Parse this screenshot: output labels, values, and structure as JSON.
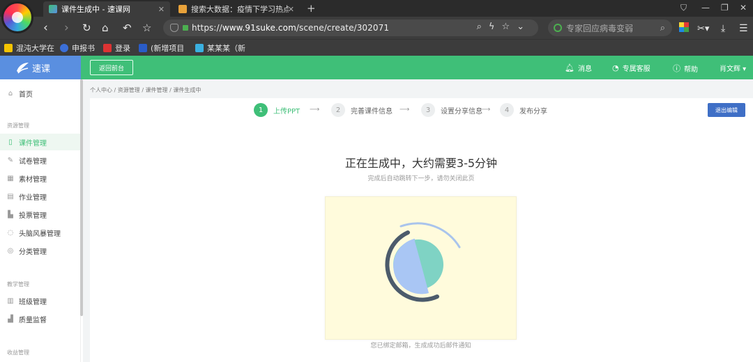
{
  "browser": {
    "tabs": [
      {
        "label": "课件生成中 - 速课网",
        "active": true
      },
      {
        "label": "搜索大数据：疫情下学习热点",
        "active": false
      }
    ],
    "address": {
      "scheme": "https://",
      "domain": "www.91suke.com",
      "path": "/scene/create/302071"
    },
    "search_placeholder": "专家回应病毒变弱",
    "bookmarks": [
      {
        "label": "混沌大学在",
        "color": "#f5c400"
      },
      {
        "label": "申报书",
        "color": "#3b6fd8"
      },
      {
        "label": "登录",
        "color": "#d33"
      },
      {
        "label": "(新增项目",
        "color": "#2a5cc8"
      },
      {
        "label": "某某某（新",
        "color": "#3ab0e0"
      }
    ]
  },
  "app": {
    "brand": "速课",
    "back_label": "返回前台",
    "header_items": [
      {
        "label": "消息",
        "icon": "bell-icon"
      },
      {
        "label": "专属客服",
        "icon": "support-icon"
      },
      {
        "label": "帮助",
        "icon": "help-icon"
      },
      {
        "label": "肖文辉 ▾",
        "icon": ""
      }
    ]
  },
  "sidebar": {
    "home": "首页",
    "groups": [
      {
        "title": "资源管理",
        "items": [
          "课件管理",
          "试卷管理",
          "素材管理",
          "作业管理",
          "投票管理",
          "头脑风暴管理",
          "分类管理"
        ]
      },
      {
        "title": "教学管理",
        "items": [
          "班级管理",
          "质量监督"
        ]
      },
      {
        "title": "收益管理",
        "items": []
      }
    ],
    "active_item": "课件管理"
  },
  "main": {
    "breadcrumb": "个人中心 / 资源管理 / 课件管理 / 课件生成中",
    "steps": [
      {
        "num": "1",
        "label": "上传PPT",
        "active": true
      },
      {
        "num": "2",
        "label": "完善课件信息",
        "active": false
      },
      {
        "num": "3",
        "label": "设置分享信息",
        "active": false
      },
      {
        "num": "4",
        "label": "发布分享",
        "active": false
      }
    ],
    "exit_label": "退出编辑",
    "title": "正在生成中，大约需要3-5分钟",
    "subtitle": "完成后自动跳转下一步，请勿关闭此页",
    "note": "您已绑定邮箱，生成成功后邮件通知",
    "colors": {
      "accent": "#3fbf78",
      "brand_blue": "#5a8fe0",
      "exit_blue": "#3f6fc6"
    }
  }
}
